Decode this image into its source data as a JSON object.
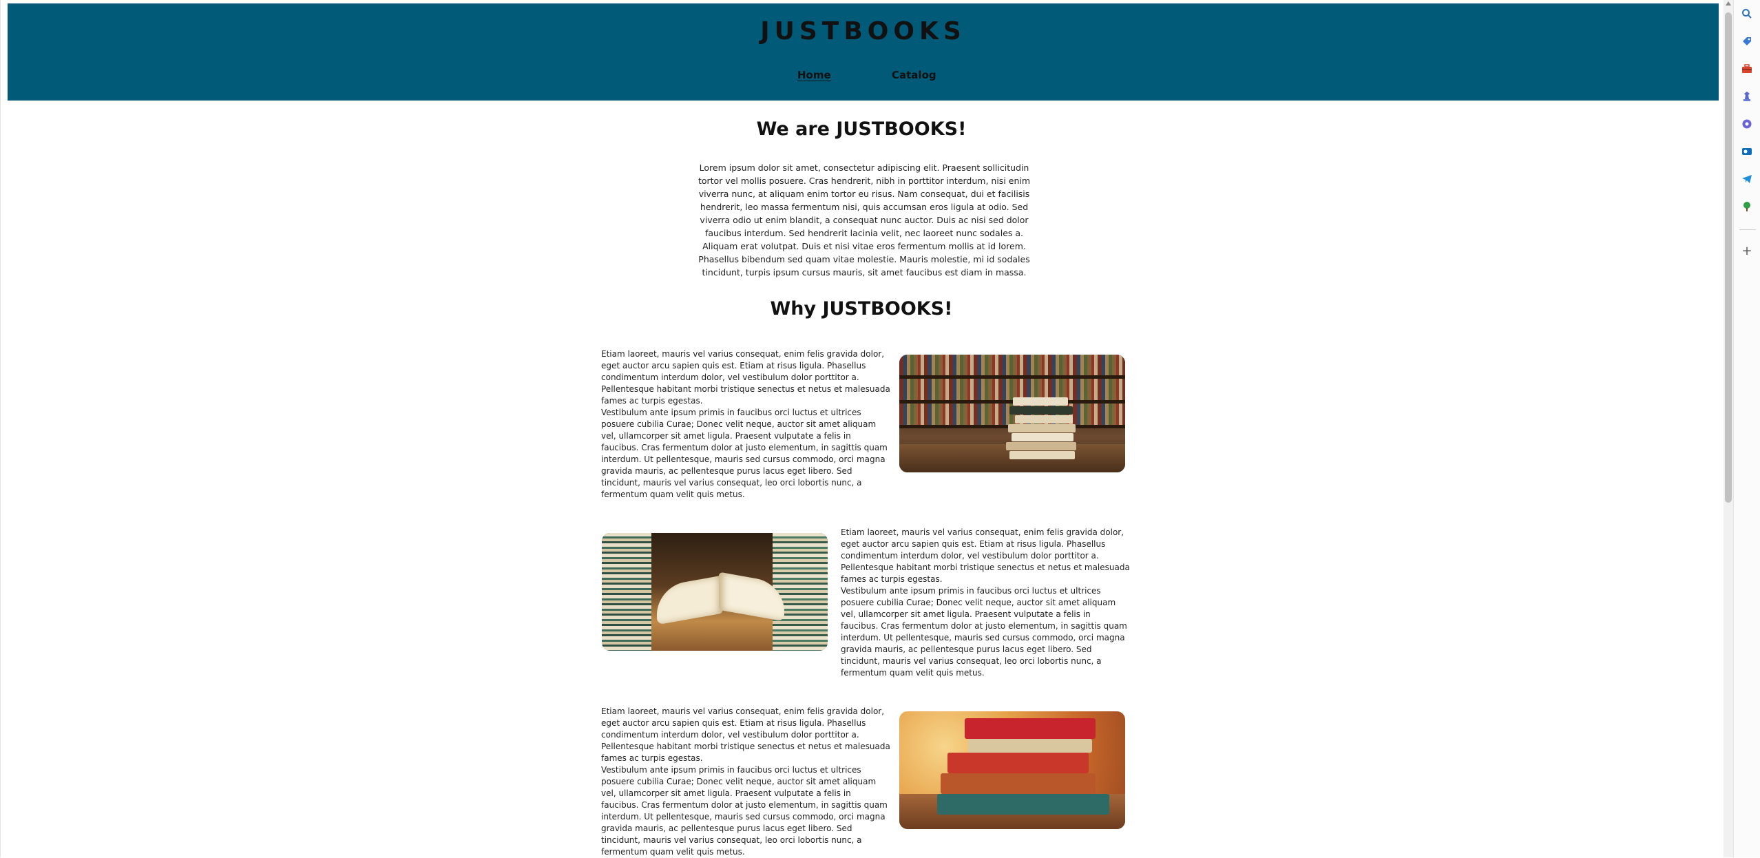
{
  "header": {
    "logo": "JUSTBOOKS",
    "nav": {
      "home": "Home",
      "catalog": "Catalog"
    }
  },
  "intro": {
    "title": "We are JUSTBOOKS!",
    "text": "Lorem ipsum dolor sit amet, consectetur adipiscing elit. Praesent sollicitudin tortor vel mollis posuere. Cras hendrerit, nibh in porttitor interdum, nisi enim viverra nunc, at aliquam enim tortor eu risus. Nam consequat, dui et facilisis hendrerit, leo massa fermentum nisi, quis accumsan eros ligula at odio. Sed viverra odio ut enim blandit, a consequat nunc auctor. Duis ac nisi sed dolor faucibus interdum. Sed hendrerit lacinia velit, nec laoreet nunc sodales a. Aliquam erat volutpat. Duis et nisi vitae eros fermentum mollis at id lorem. Phasellus bibendum sed quam vitae molestie. Mauris molestie, mi id sodales tincidunt, turpis ipsum cursus mauris, sit amet faucibus est diam in massa."
  },
  "why": {
    "title": "Why JUSTBOOKS!",
    "features": [
      {
        "para1": "Etiam laoreet, mauris vel varius consequat, enim felis gravida dolor, eget auctor arcu sapien quis est. Etiam at risus ligula. Phasellus condimentum interdum dolor, vel vestibulum dolor porttitor a. Pellentesque habitant morbi tristique senectus et netus et malesuada fames ac turpis egestas.",
        "para2": "Vestibulum ante ipsum primis in faucibus orci luctus et ultrices posuere cubilia Curae; Donec velit neque, auctor sit amet aliquam vel, ullamcorper sit amet ligula. Praesent vulputate a felis in faucibus. Cras fermentum dolor at justo elementum, in sagittis quam interdum. Ut pellentesque, mauris sed cursus commodo, orci magna gravida mauris, ac pellentesque purus lacus eget libero. Sed tincidunt, mauris vel varius consequat, leo orci lobortis nunc, a fermentum quam velit quis metus."
      },
      {
        "para1": "Etiam laoreet, mauris vel varius consequat, enim felis gravida dolor, eget auctor arcu sapien quis est. Etiam at risus ligula. Phasellus condimentum interdum dolor, vel vestibulum dolor porttitor a. Pellentesque habitant morbi tristique senectus et netus et malesuada fames ac turpis egestas.",
        "para2": "Vestibulum ante ipsum primis in faucibus orci luctus et ultrices posuere cubilia Curae; Donec velit neque, auctor sit amet aliquam vel, ullamcorper sit amet ligula. Praesent vulputate a felis in faucibus. Cras fermentum dolor at justo elementum, in sagittis quam interdum. Ut pellentesque, mauris sed cursus commodo, orci magna gravida mauris, ac pellentesque purus lacus eget libero. Sed tincidunt, mauris vel varius consequat, leo orci lobortis nunc, a fermentum quam velit quis metus."
      },
      {
        "para1": "Etiam laoreet, mauris vel varius consequat, enim felis gravida dolor, eget auctor arcu sapien quis est. Etiam at risus ligula. Phasellus condimentum interdum dolor, vel vestibulum dolor porttitor a. Pellentesque habitant morbi tristique senectus et netus et malesuada fames ac turpis egestas.",
        "para2": "Vestibulum ante ipsum primis in faucibus orci luctus et ultrices posuere cubilia Curae; Donec velit neque, auctor sit amet aliquam vel, ullamcorper sit amet ligula. Praesent vulputate a felis in faucibus. Cras fermentum dolor at justo elementum, in sagittis quam interdum. Ut pellentesque, mauris sed cursus commodo, orci magna gravida mauris, ac pellentesque purus lacus eget libero. Sed tincidunt, mauris vel varius consequat, leo orci lobortis nunc, a fermentum quam velit quis metus."
      }
    ]
  },
  "colors": {
    "header_bg": "#005a78"
  },
  "browser_sidebar": {
    "icons": [
      "search-icon",
      "tag-icon",
      "toolbox-icon",
      "chess-icon",
      "extension-icon",
      "outlook-icon",
      "telegram-icon",
      "tree-icon",
      "add-icon"
    ]
  }
}
